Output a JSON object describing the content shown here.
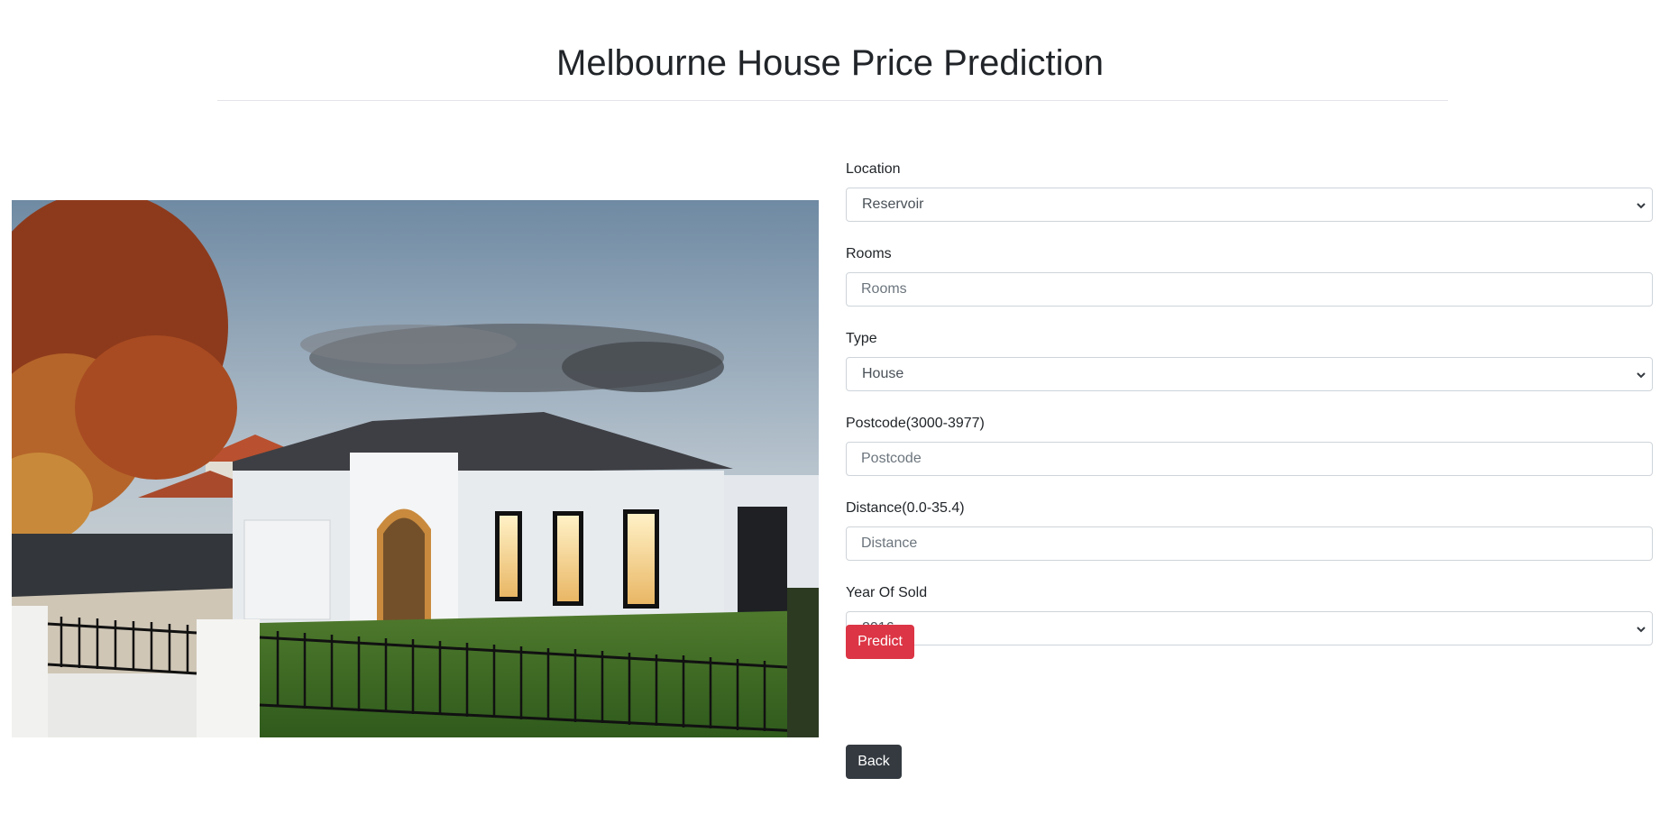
{
  "header": {
    "title": "Melbourne House Price Prediction"
  },
  "form": {
    "location": {
      "label": "Location",
      "value": "Reservoir"
    },
    "rooms": {
      "label": "Rooms",
      "placeholder": "Rooms"
    },
    "type": {
      "label": "Type",
      "value": "House"
    },
    "postcode": {
      "label": "Postcode(3000-3977)",
      "placeholder": "Postcode"
    },
    "distance": {
      "label": "Distance(0.0-35.4)",
      "placeholder": "Distance"
    },
    "year": {
      "label": "Year Of Sold",
      "value": "2016"
    },
    "predict_label": "Predict",
    "back_label": "Back"
  },
  "colors": {
    "predict": "#dc3545",
    "back": "#343a40",
    "border": "#ced4da"
  },
  "icons": {
    "select_arrow": "chevron-down-icon"
  }
}
